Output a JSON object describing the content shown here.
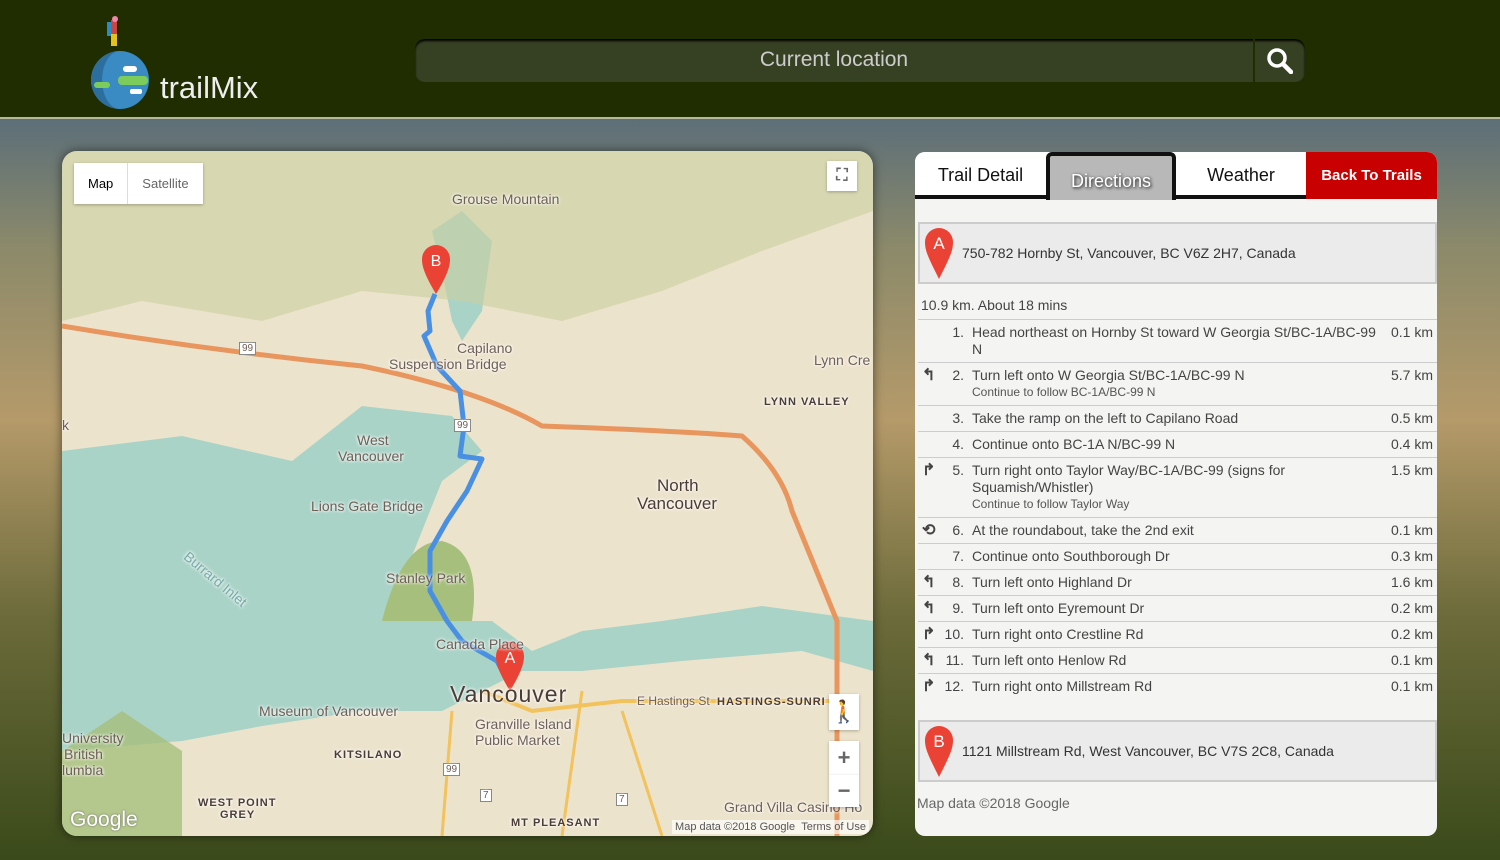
{
  "header": {
    "brand": "trailMix",
    "search_placeholder": "Current location"
  },
  "map": {
    "type_buttons": [
      "Map",
      "Satellite"
    ],
    "labels": {
      "grouse": "Grouse Mountain",
      "capilano": "Capilano",
      "suspension": "Suspension Bridge",
      "lynn": "Lynn Cre",
      "lynn_valley": "LYNN VALLEY",
      "west_van1": "West",
      "west_van2": "Vancouver",
      "north_van1": "North",
      "north_van2": "Vancouver",
      "lions": "Lions Gate Bridge",
      "burrard": "Burrard Inlet",
      "stanley": "Stanley Park",
      "canada_place": "Canada Place",
      "vancouver": "Vancouver",
      "hastings_st": "E Hastings St",
      "hastings_sunrise": "HASTINGS-SUNRI",
      "museum": "Museum of Vancouver",
      "granville1": "Granville Island",
      "granville2": "Public Market",
      "ubc1": "University",
      "ubc2": "British",
      "ubc3": "lumbia",
      "kitsilano": "KITSILANO",
      "wpg1": "WEST POINT",
      "wpg2": "GREY",
      "mt_pleasant": "MT PLEASANT",
      "grand_villa": "Grand Villa Casino Ho",
      "k": "k"
    },
    "shields": [
      "99",
      "99",
      "99",
      "7",
      "7"
    ],
    "markers": {
      "start": "A",
      "end": "B"
    },
    "zoom_in": "+",
    "zoom_out": "−",
    "google": "Google",
    "attribution": "Map data ©2018 Google",
    "terms": "Terms of Use"
  },
  "panel": {
    "tabs": [
      "Trail Detail",
      "Directions",
      "Weather",
      "Back To Trails"
    ],
    "active_tab": "Directions",
    "start": {
      "marker": "A",
      "address": "750-782 Hornby St, Vancouver, BC V6Z 2H7, Canada"
    },
    "summary": "10.9 km. About 18 mins",
    "steps": [
      {
        "icon": "",
        "num": "1.",
        "text": "Head northeast on Hornby St toward W Georgia St/BC-1A/BC-99 N",
        "sub": "",
        "dist": "0.1 km"
      },
      {
        "icon": "turn-left",
        "num": "2.",
        "text": "Turn left onto W Georgia St/BC-1A/BC-99 N",
        "sub": "Continue to follow BC-1A/BC-99 N",
        "dist": "5.7 km"
      },
      {
        "icon": "",
        "num": "3.",
        "text": "Take the ramp on the left to Capilano Road",
        "sub": "",
        "dist": "0.5 km"
      },
      {
        "icon": "",
        "num": "4.",
        "text": "Continue onto BC-1A N/BC-99 N",
        "sub": "",
        "dist": "0.4 km"
      },
      {
        "icon": "turn-right",
        "num": "5.",
        "text": "Turn right onto Taylor Way/BC-1A/BC-99 (signs for Squamish/Whistler)",
        "sub": "Continue to follow Taylor Way",
        "dist": "1.5 km"
      },
      {
        "icon": "roundabout",
        "num": "6.",
        "text": "At the roundabout, take the 2nd exit",
        "sub": "",
        "dist": "0.1 km"
      },
      {
        "icon": "",
        "num": "7.",
        "text": "Continue onto Southborough Dr",
        "sub": "",
        "dist": "0.3 km"
      },
      {
        "icon": "turn-left",
        "num": "8.",
        "text": "Turn left onto Highland Dr",
        "sub": "",
        "dist": "1.6 km"
      },
      {
        "icon": "turn-left",
        "num": "9.",
        "text": "Turn left onto Eyremount Dr",
        "sub": "",
        "dist": "0.2 km"
      },
      {
        "icon": "turn-right",
        "num": "10.",
        "text": "Turn right onto Crestline Rd",
        "sub": "",
        "dist": "0.2 km"
      },
      {
        "icon": "turn-left",
        "num": "11.",
        "text": "Turn left onto Henlow Rd",
        "sub": "",
        "dist": "0.1 km"
      },
      {
        "icon": "turn-right",
        "num": "12.",
        "text": "Turn right onto Millstream Rd",
        "sub": "",
        "dist": "0.1 km"
      }
    ],
    "end": {
      "marker": "B",
      "address": "1121 Millstream Rd, West Vancouver, BC V7S 2C8, Canada"
    },
    "footer": "Map data ©2018 Google"
  },
  "colors": {
    "header": "#1f2d00",
    "route": "#4a90e2",
    "marker": "#ea4335",
    "back_button": "#c90000"
  }
}
